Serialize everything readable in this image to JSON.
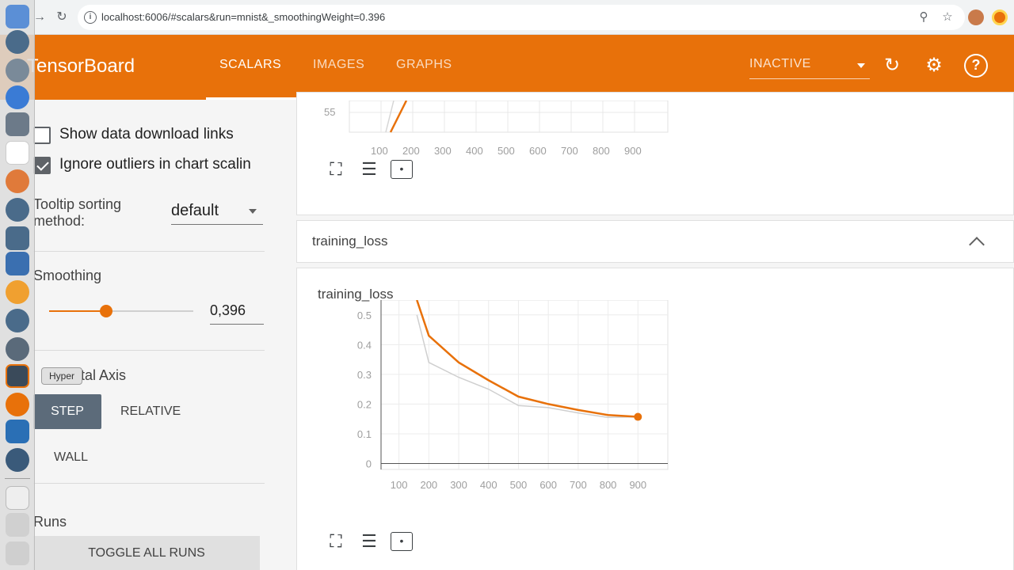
{
  "browser": {
    "url": "localhost:6006/#scalars&run=mnist&_smoothingWeight=0.396"
  },
  "dock": {
    "tooltip": "Hyper"
  },
  "header": {
    "title": "TensorBoard",
    "tabs": [
      {
        "label": "SCALARS",
        "active": true
      },
      {
        "label": "IMAGES",
        "active": false
      },
      {
        "label": "GRAPHS",
        "active": false
      }
    ],
    "status_select": "INACTIVE",
    "accent_color": "#e8710a"
  },
  "sidebar": {
    "show_download_links": {
      "label": "Show data download links",
      "checked": false
    },
    "ignore_outliers": {
      "label": "Ignore outliers in chart scalin",
      "checked": true
    },
    "tooltip_sorting": {
      "label_line1": "Tooltip sorting",
      "label_line2": "method:",
      "value": "default"
    },
    "smoothing": {
      "label": "Smoothing",
      "value": "0,396",
      "fraction": 0.396
    },
    "horizontal_axis": {
      "label": "tal Axis",
      "active": "STEP",
      "options": [
        "STEP",
        "RELATIVE",
        "WALL"
      ]
    },
    "runs": {
      "label": "Runs",
      "toggle_label": "TOGGLE ALL RUNS"
    }
  },
  "top_chart": {
    "y_tick_visible": "55",
    "x_ticks": [
      "100",
      "200",
      "300",
      "400",
      "500",
      "600",
      "700",
      "800",
      "900"
    ]
  },
  "section": {
    "title": "training_loss"
  },
  "chart_data": {
    "type": "line",
    "title": "training_loss",
    "xlabel": "",
    "ylabel": "",
    "x": [
      160,
      200,
      300,
      400,
      500,
      600,
      700,
      800,
      900
    ],
    "series": [
      {
        "values": [
          0.55,
          0.43,
          0.34,
          0.28,
          0.225,
          0.2,
          0.18,
          0.163,
          0.157
        ],
        "color": "#e8710a"
      },
      {
        "values": [
          0.5,
          0.34,
          0.29,
          0.25,
          0.195,
          0.188,
          0.17,
          0.155,
          0.157
        ],
        "color": "#cfcfcf"
      }
    ],
    "y_ticks": [
      "0",
      "0.1",
      "0.2",
      "0.3",
      "0.4",
      "0.5"
    ],
    "x_ticks": [
      "100",
      "200",
      "300",
      "400",
      "500",
      "600",
      "700",
      "800",
      "900"
    ],
    "xlim": [
      40,
      1000
    ],
    "ylim": [
      -0.02,
      0.55
    ],
    "grid": true
  }
}
